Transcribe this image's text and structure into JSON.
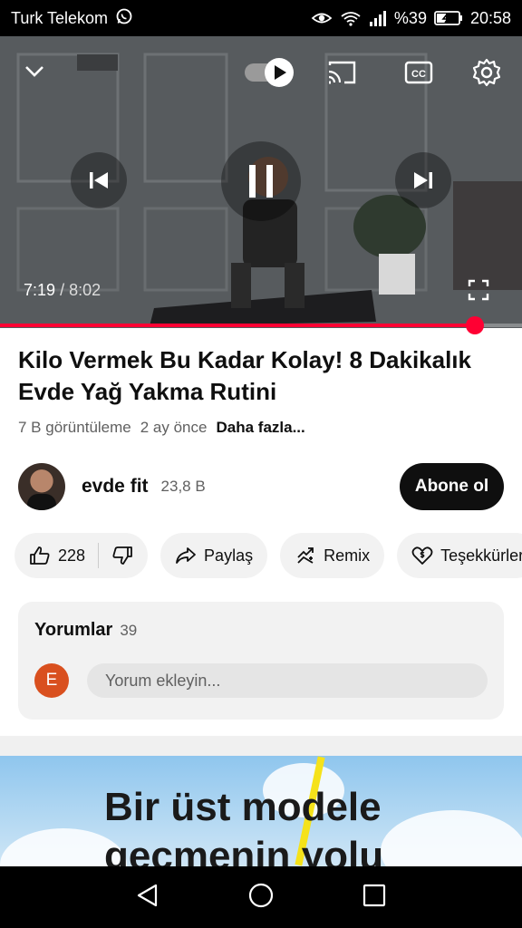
{
  "status_bar": {
    "carrier": "Turk Telekom",
    "battery": "%39",
    "time": "20:58"
  },
  "player": {
    "current_time": "7:19",
    "duration": "/ 8:02",
    "progress_fraction": 0.91,
    "autoplay_on": true
  },
  "video": {
    "title": "Kilo Vermek Bu Kadar Kolay! 8 Dakikalık Evde Yağ Yakma Rutini",
    "views": "7 B görüntüleme",
    "age": "2 ay önce",
    "more_label": "Daha fazla..."
  },
  "channel": {
    "name": "evde fit",
    "subscribers": "23,8 B",
    "subscribe_label": "Abone ol"
  },
  "actions": {
    "like_count": "228",
    "share_label": "Paylaş",
    "remix_label": "Remix",
    "thanks_label": "Teşekkürler"
  },
  "comments": {
    "header": "Yorumlar",
    "count": "39",
    "user_initial": "E",
    "placeholder": "Yorum ekleyin..."
  },
  "ad": {
    "line1": "Bir üst modele",
    "line2": "geçmenin yolu"
  },
  "colors": {
    "accent_red": "#ff0033",
    "avatar_orange": "#d9501f"
  }
}
